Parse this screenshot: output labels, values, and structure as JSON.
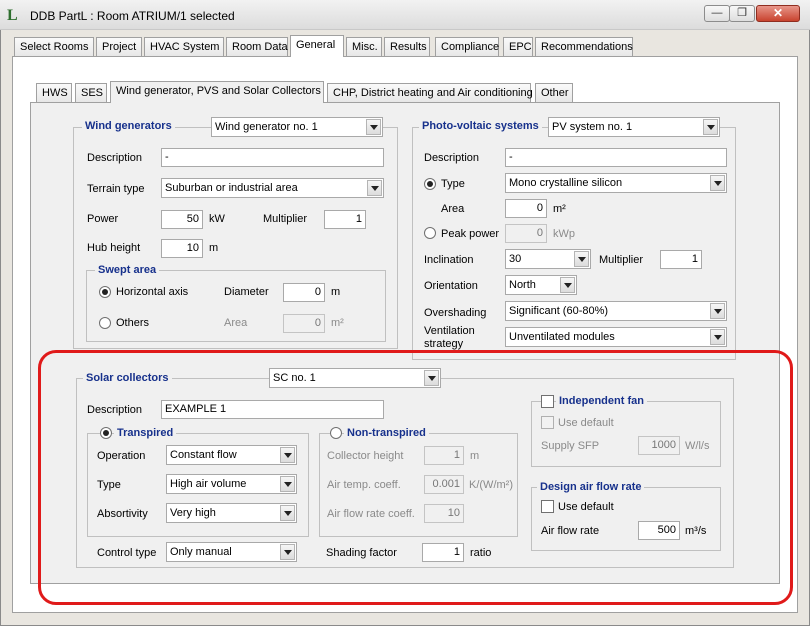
{
  "window": {
    "logo": "L",
    "title": "DDB PartL : Room ATRIUM/1 selected",
    "minimize_icon": "minimize-icon",
    "restore_icon": "restore-icon",
    "close_icon": "close-icon"
  },
  "main_tabs": [
    "Select Rooms",
    "Project",
    "HVAC System",
    "Room Data",
    "General",
    "Misc.",
    "Results",
    "Compliance",
    "EPC",
    "Recommendations"
  ],
  "main_tabs_active": "General",
  "sub_tabs": [
    "HWS",
    "SES",
    "Wind generator, PVS and Solar Collectors",
    "CHP, District heating and Air conditioning",
    "Other"
  ],
  "sub_tabs_active": "Wind generator, PVS and Solar Collectors",
  "wind": {
    "title": "Wind generators",
    "selector": "Wind generator no. 1",
    "description_label": "Description",
    "description_value": "-",
    "terrain_label": "Terrain type",
    "terrain_value": "Suburban or industrial area",
    "power_label": "Power",
    "power_value": "50",
    "power_unit": "kW",
    "multiplier_label": "Multiplier",
    "multiplier_value": "1",
    "hub_label": "Hub height",
    "hub_value": "10",
    "hub_unit": "m",
    "swept": {
      "title": "Swept area",
      "horizontal_label": "Horizontal axis",
      "horizontal_selected": true,
      "diameter_label": "Diameter",
      "diameter_value": "0",
      "diameter_unit": "m",
      "others_label": "Others",
      "area_label": "Area",
      "area_value": "0",
      "area_unit": "m²"
    }
  },
  "pv": {
    "title": "Photo-voltaic systems",
    "selector": "PV system no. 1",
    "description_label": "Description",
    "description_value": "-",
    "type_label": "Type",
    "type_value": "Mono crystalline silicon",
    "area_label": "Area",
    "area_value": "0",
    "area_unit": "m²",
    "peak_label": "Peak power",
    "peak_value": "0",
    "peak_unit": "kWp",
    "inclination_label": "Inclination",
    "inclination_value": "30",
    "multiplier_label": "Multiplier",
    "multiplier_value": "1",
    "orientation_label": "Orientation",
    "orientation_value": "North",
    "overshading_label": "Overshading",
    "overshading_value": "Significant (60-80%)",
    "ventilation_label_1": "Ventilation",
    "ventilation_label_2": "strategy",
    "ventilation_value": "Unventilated modules"
  },
  "solar": {
    "title": "Solar collectors",
    "selector": "SC no. 1",
    "description_label": "Description",
    "description_value": "EXAMPLE 1",
    "transpired": {
      "title": "Transpired",
      "selected": true,
      "operation_label": "Operation",
      "operation_value": "Constant flow",
      "type_label": "Type",
      "type_value": "High air volume",
      "absorptivity_label": "Absortivity",
      "absorptivity_value": "Very high"
    },
    "non_transpired": {
      "title": "Non-transpired",
      "collector_height_label": "Collector height",
      "collector_height_value": "1",
      "collector_height_unit": "m",
      "air_temp_label": "Air temp. coeff.",
      "air_temp_value": "0.001",
      "air_temp_unit": "K/(W/m²)",
      "air_flow_coeff_label": "Air flow rate coeff.",
      "air_flow_coeff_value": "10"
    },
    "control_type_label": "Control type",
    "control_type_value": "Only manual",
    "shading_label": "Shading factor",
    "shading_value": "1",
    "shading_unit": "ratio",
    "independent_fan": {
      "title": "Independent fan",
      "use_default_label": "Use default",
      "sfp_label": "Supply SFP",
      "sfp_value": "1000",
      "sfp_unit": "W/l/s"
    },
    "design_air_flow": {
      "title": "Design air flow rate",
      "use_default_label": "Use default",
      "rate_label": "Air flow rate",
      "rate_value": "500",
      "rate_unit": "m³/s"
    }
  },
  "colors": {
    "group_title": "#17318c",
    "highlight": "#e01a1a"
  }
}
